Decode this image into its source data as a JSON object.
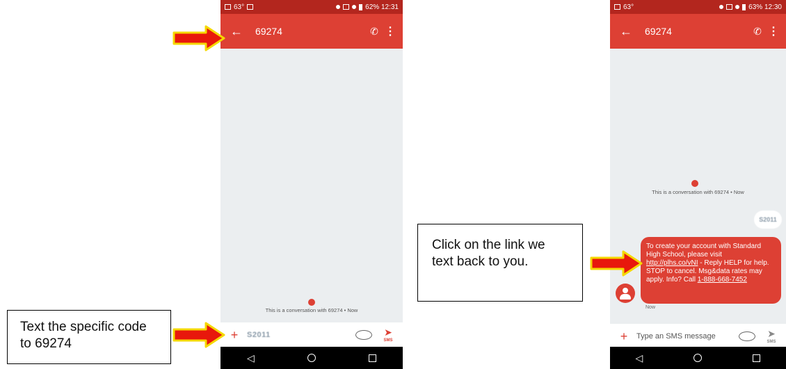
{
  "phone_left": {
    "status": {
      "left": "63°",
      "right": "62% 12:31"
    },
    "appbar": {
      "back_icon": "arrow-left-icon",
      "title": "69274",
      "call_icon": "phone-icon",
      "more_icon": "more-vert-icon"
    },
    "system_message": "This is a conversation with 69274 • Now",
    "input": {
      "value": "S2011",
      "send_label": "SMS"
    }
  },
  "phone_right": {
    "status": {
      "left": "63°",
      "right": "63% 12:30"
    },
    "appbar": {
      "back_icon": "arrow-left-icon",
      "title": "69274",
      "call_icon": "phone-icon",
      "more_icon": "more-vert-icon"
    },
    "system_message": "This is a conversation with 69274 • Now",
    "outgoing_message": "S2011",
    "incoming_message": {
      "text_before_link": "To create your account with Standard High School, please visit ",
      "link": "http://plhs.co/vNI",
      "text_after_link": " - Reply HELP for help. STOP to cancel. Msg&data rates may apply. Info? Call ",
      "phone_link": "1-888-668-7452",
      "time": "Now"
    },
    "input": {
      "placeholder": "Type an SMS message",
      "send_label": "SMS"
    }
  },
  "callouts": {
    "left": "Text the specific code to 69274",
    "right": "Click on the link we text back to you."
  },
  "colors": {
    "accent": "#dd4034",
    "status_bar": "#b3261e",
    "arrow_fill": "#e8180c",
    "arrow_outline": "#f5d800"
  }
}
